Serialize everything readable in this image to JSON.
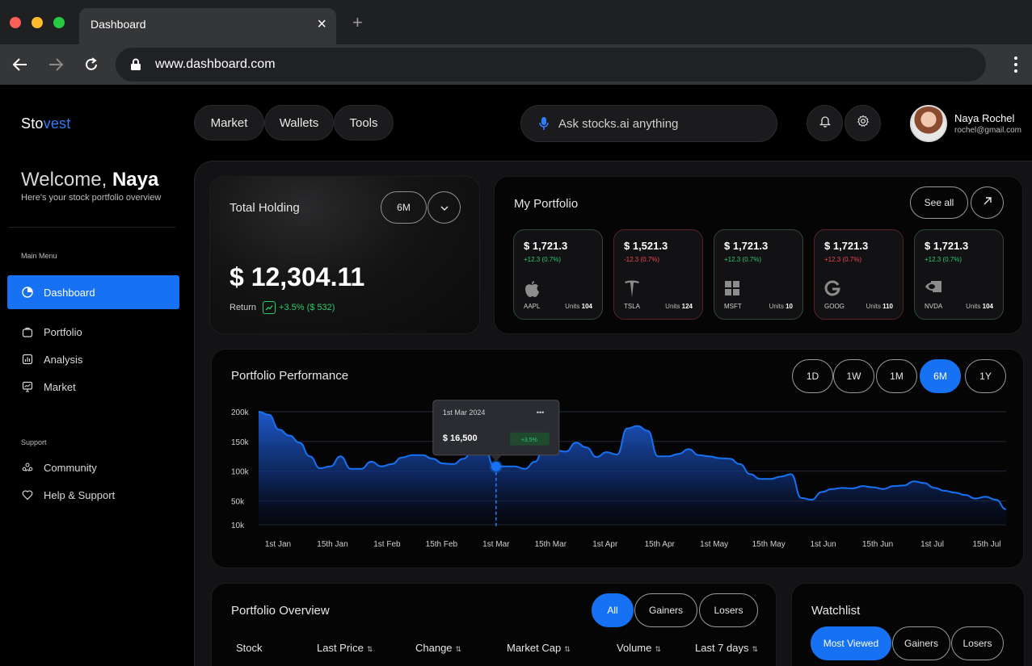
{
  "browser": {
    "tab_title": "Dashboard",
    "url": "www.dashboard.com"
  },
  "brand": {
    "name_start": "Sto",
    "name_end": "vest"
  },
  "topnav": {
    "items": [
      "Market",
      "Wallets",
      "Tools"
    ]
  },
  "search": {
    "placeholder": "Ask  stocks.ai anything"
  },
  "user": {
    "name": "Naya Rochel",
    "email": "rochel@gmail.com"
  },
  "sidebar": {
    "welcome_prefix": "Welcome,",
    "welcome_name": "Naya",
    "welcome_sub": "Here's your stock portfolio overview",
    "main_menu_label": "Main Menu",
    "main_items": [
      {
        "label": "Dashboard",
        "icon": "pie-chart-icon"
      },
      {
        "label": "Portfolio",
        "icon": "briefcase-icon"
      },
      {
        "label": "Analysis",
        "icon": "analysis-icon"
      },
      {
        "label": "Market",
        "icon": "monitor-icon"
      }
    ],
    "support_label": "Support",
    "support_items": [
      {
        "label": "Community",
        "icon": "community-icon"
      },
      {
        "label": "Help & Support",
        "icon": "help-icon"
      }
    ]
  },
  "holding": {
    "title": "Total Holding",
    "period": "6M",
    "amount": "$ 12,304.11",
    "return_label": "Return",
    "return_value": "+3.5% ($ 532)"
  },
  "portfolio": {
    "title": "My Portfolio",
    "see_all": "See all",
    "stocks": [
      {
        "price": "$ 1,721.3",
        "change": "+12.3 (0.7%)",
        "ticker": "AAPL",
        "units_label": "Units",
        "units": "104",
        "trend": "up",
        "icon": "apple-icon"
      },
      {
        "price": "$ 1,521.3",
        "change": "-12.3 (0.7%)",
        "ticker": "TSLA",
        "units_label": "Units",
        "units": "124",
        "trend": "down",
        "icon": "tesla-icon"
      },
      {
        "price": "$ 1,721.3",
        "change": "+12.3 (0.7%)",
        "ticker": "MSFT",
        "units_label": "Units",
        "units": "10",
        "trend": "up",
        "icon": "windows-icon"
      },
      {
        "price": "$ 1,721.3",
        "change": "+12.3 (0.7%)",
        "ticker": "GOOG",
        "units_label": "Units",
        "units": "110",
        "trend": "down",
        "icon": "google-icon"
      },
      {
        "price": "$ 1,721.3",
        "change": "+12.3 (0.7%)",
        "ticker": "NVDA",
        "units_label": "Units",
        "units": "104",
        "trend": "up",
        "icon": "nvidia-icon"
      }
    ]
  },
  "performance": {
    "title": "Portfolio Performance",
    "ranges": [
      "1D",
      "1W",
      "1M",
      "6M",
      "1Y"
    ],
    "active_range": "6M",
    "tooltip": {
      "date": "1st Mar 2024",
      "value": "$ 16,500",
      "badge": "+3.5%"
    }
  },
  "chart_data": {
    "type": "area",
    "title": "",
    "xlabel": "",
    "ylabel": "",
    "x_ticks": [
      "1st Jan",
      "15th Jan",
      "1st Feb",
      "15th Feb",
      "1st Mar",
      "15th Mar",
      "1st Apr",
      "15th Apr",
      "1st May",
      "15th May",
      "1st Jun",
      "15th Jun",
      "1st Jul",
      "15th Jul"
    ],
    "y_ticks": [
      "200k",
      "150k",
      "100k",
      "50k",
      "10k"
    ],
    "y_tick_values": [
      200,
      150,
      100,
      50,
      10
    ],
    "ylim": [
      10,
      200
    ],
    "grid": true,
    "highlight_x": "1st Mar",
    "color": "#1672f3",
    "values": [
      200,
      195,
      170,
      160,
      148,
      125,
      105,
      108,
      125,
      104,
      104,
      116,
      108,
      112,
      123,
      127,
      127,
      121,
      113,
      112,
      121,
      136,
      143,
      108,
      108,
      108,
      104,
      116,
      150,
      135,
      133,
      148,
      140,
      124,
      132,
      128,
      172,
      176,
      168,
      125,
      125,
      129,
      137,
      127,
      125,
      122,
      121,
      112,
      95,
      87,
      87,
      91,
      95,
      55,
      52,
      65,
      70,
      72,
      71,
      75,
      73,
      70,
      75,
      76,
      83,
      80,
      72,
      67,
      64,
      60,
      54,
      57,
      52,
      36
    ]
  },
  "overview": {
    "title": "Portfolio Overview",
    "filters": [
      "All",
      "Gainers",
      "Losers"
    ],
    "columns": [
      "Stock",
      "Last Price",
      "Change",
      "Market Cap",
      "Volume",
      "Last 7 days"
    ]
  },
  "watchlist": {
    "title": "Watchlist",
    "filters": [
      "Most Viewed",
      "Gainers",
      "Losers"
    ]
  },
  "colors": {
    "accent": "#1672f3",
    "up": "#2fc96a",
    "down": "#f0484e"
  }
}
